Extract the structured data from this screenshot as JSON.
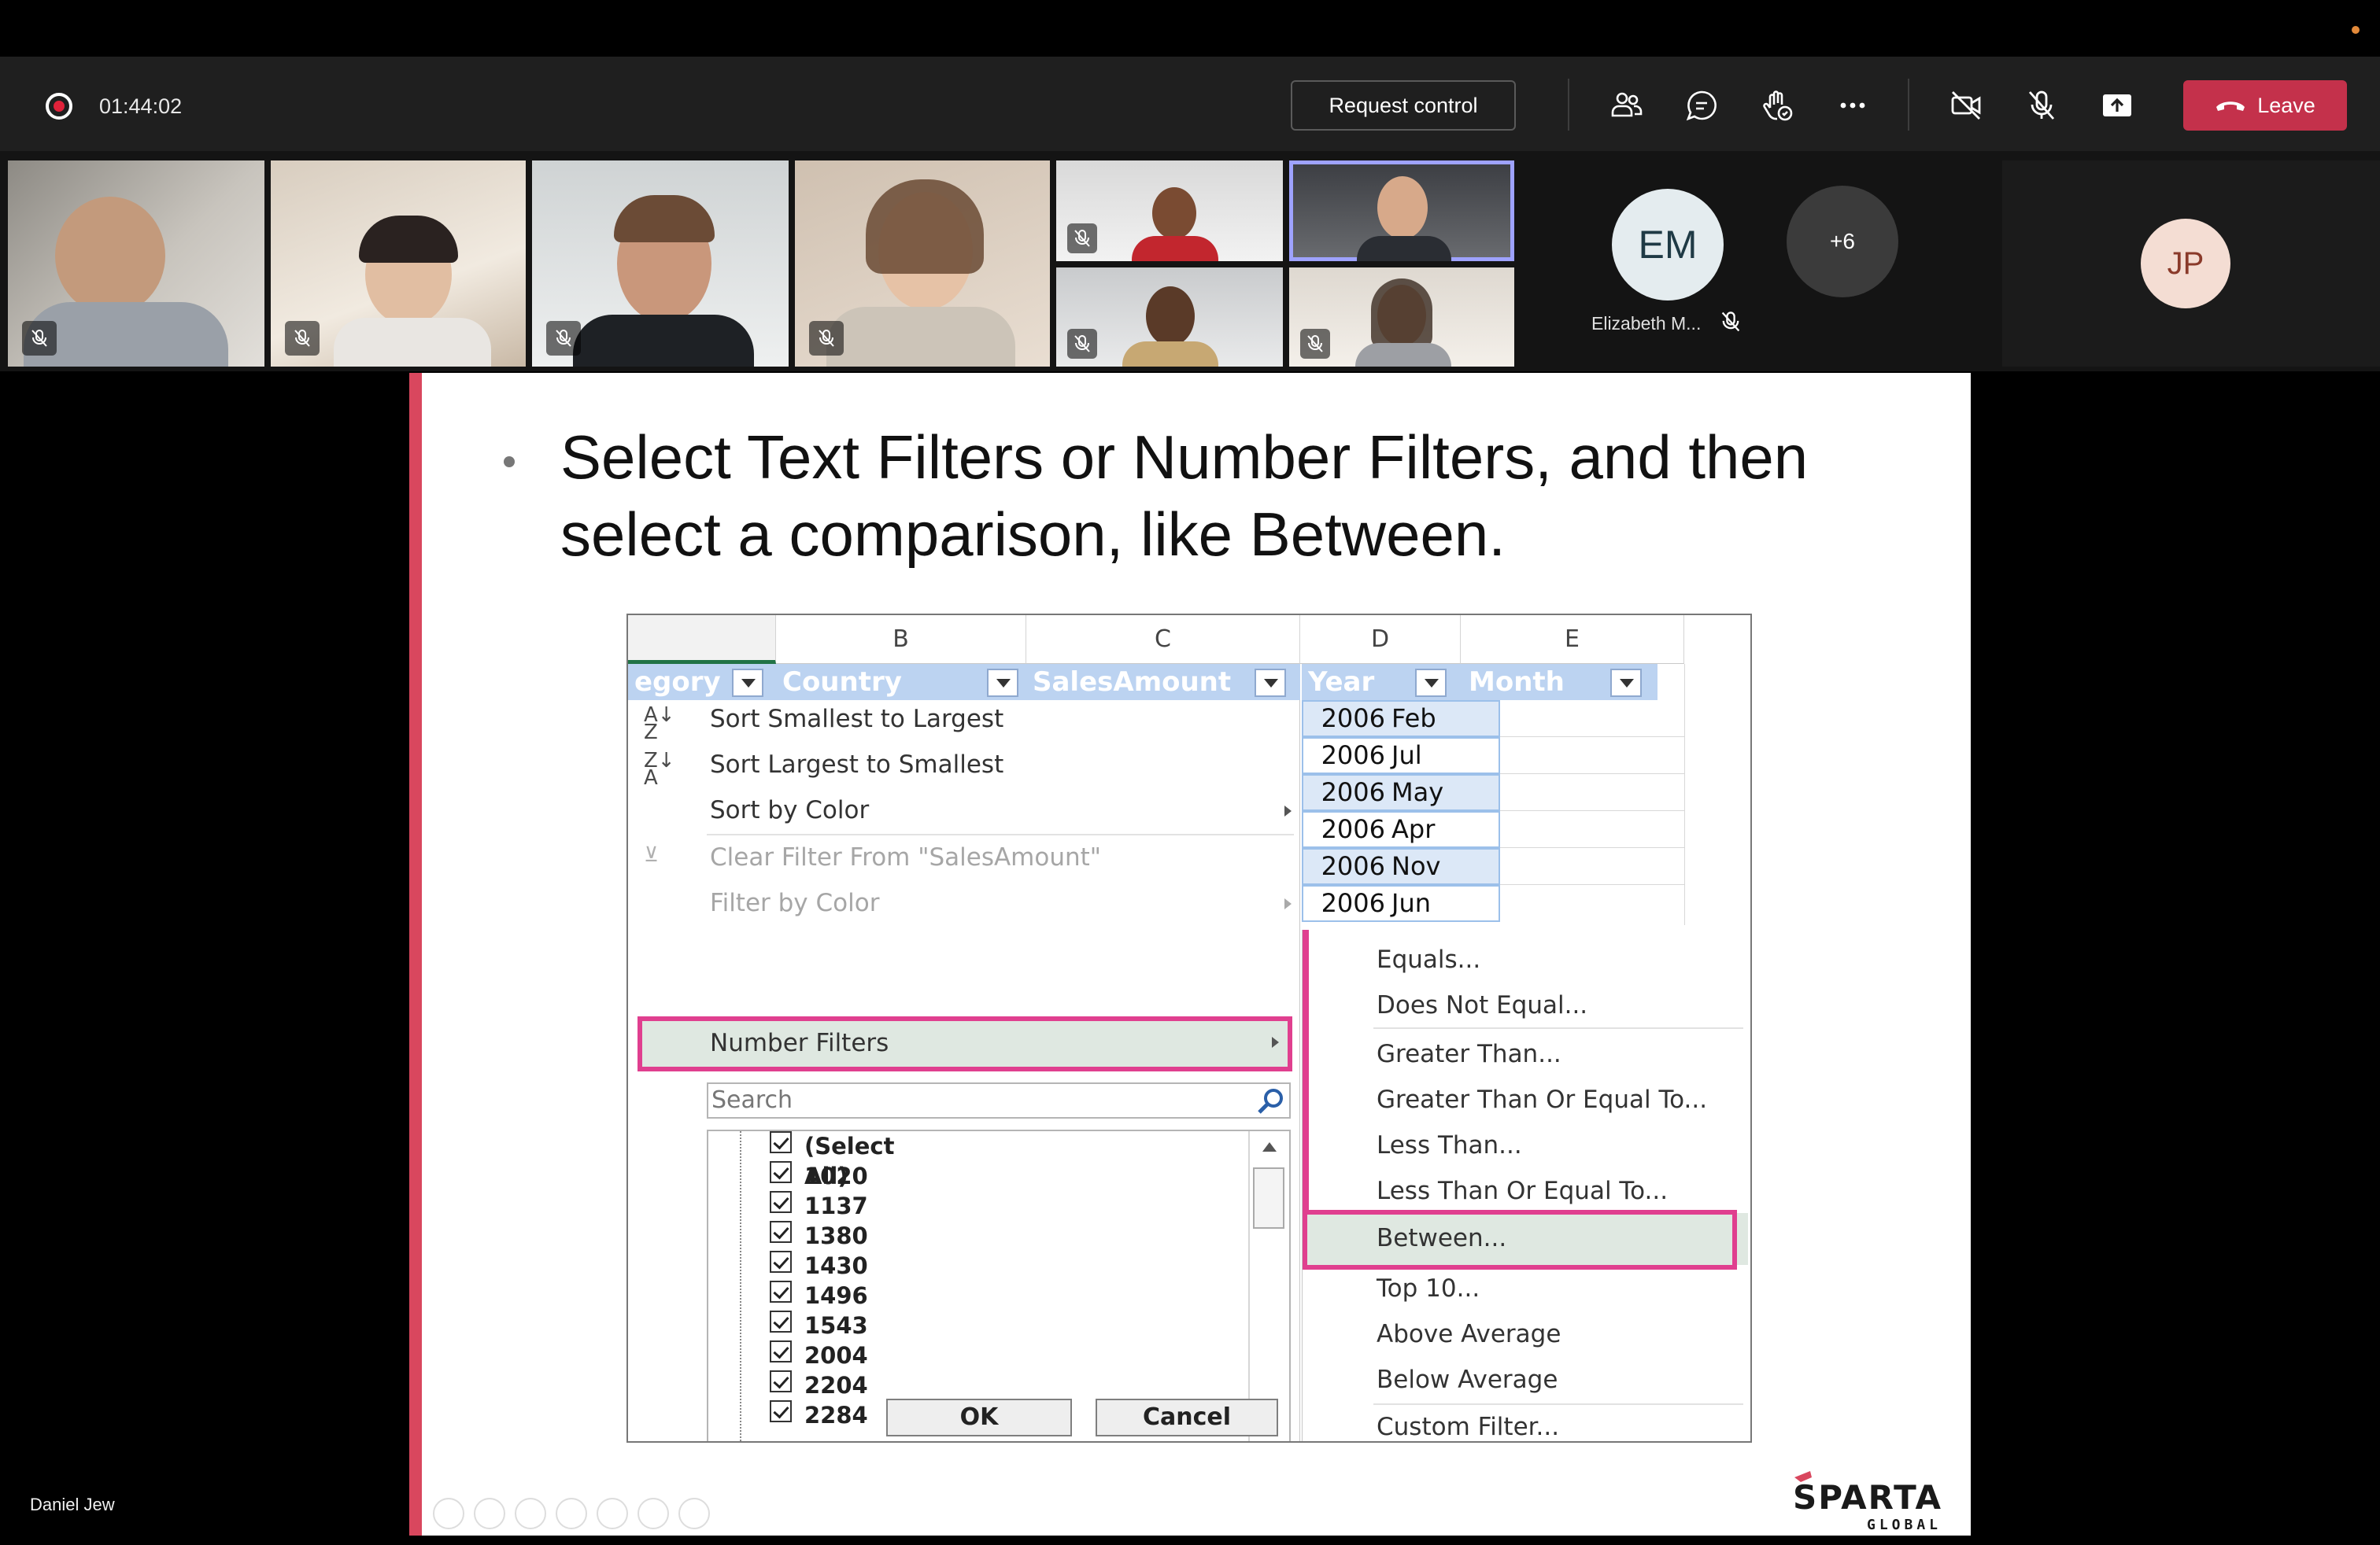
{
  "meeting": {
    "elapsed_time": "01:44:02",
    "request_control_label": "Request control",
    "leave_label": "Leave",
    "colors": {
      "leave": "#c4314b",
      "recording": "#e0223a",
      "highlight": "#e03f8f"
    },
    "toolbar_icons": [
      "people-icon",
      "chat-icon",
      "raise-hand-icon",
      "more-icon",
      "camera-off-icon",
      "mic-off-icon",
      "share-screen-icon",
      "phone-icon"
    ]
  },
  "participants": {
    "avatars": [
      {
        "initials": "EM",
        "name": "Elizabeth M..."
      },
      {
        "initials": "JP"
      }
    ],
    "overflow_count": "+6"
  },
  "stage": {
    "presenter_name": "Daniel Jew"
  },
  "slide": {
    "bullet_text": "Select Text Filters or Number Filters, and then select a comparison, like Between.",
    "logo_text": "SPARTA",
    "logo_subtext": "GLOBAL"
  },
  "excel": {
    "column_letters": [
      "B",
      "C",
      "D",
      "E"
    ],
    "table_headers": [
      "egory",
      "Country",
      "SalesAmount",
      "Year",
      "Month"
    ],
    "rows": [
      {
        "year": "2006",
        "month": "Feb"
      },
      {
        "year": "2006",
        "month": "Jul"
      },
      {
        "year": "2006",
        "month": "May"
      },
      {
        "year": "2006",
        "month": "Apr"
      },
      {
        "year": "2006",
        "month": "Nov"
      },
      {
        "year": "2006",
        "month": "Jun"
      }
    ],
    "menu": {
      "sort_asc": "Sort Smallest to Largest",
      "sort_desc": "Sort Largest to Smallest",
      "sort_color": "Sort by Color",
      "clear_filter": "Clear Filter From \"SalesAmount\"",
      "filter_color": "Filter by Color",
      "number_filters": "Number Filters",
      "search_placeholder": "Search",
      "checklist": [
        "(Select All)",
        "1020",
        "1137",
        "1380",
        "1430",
        "1496",
        "1543",
        "2004",
        "2204",
        "2284"
      ],
      "ok": "OK",
      "cancel": "Cancel"
    },
    "submenu": [
      "Equals...",
      "Does Not Equal...",
      "Greater Than...",
      "Greater Than Or Equal To...",
      "Less Than...",
      "Less Than Or Equal To...",
      "Between...",
      "Top 10...",
      "Above Average",
      "Below Average",
      "Custom Filter..."
    ]
  }
}
